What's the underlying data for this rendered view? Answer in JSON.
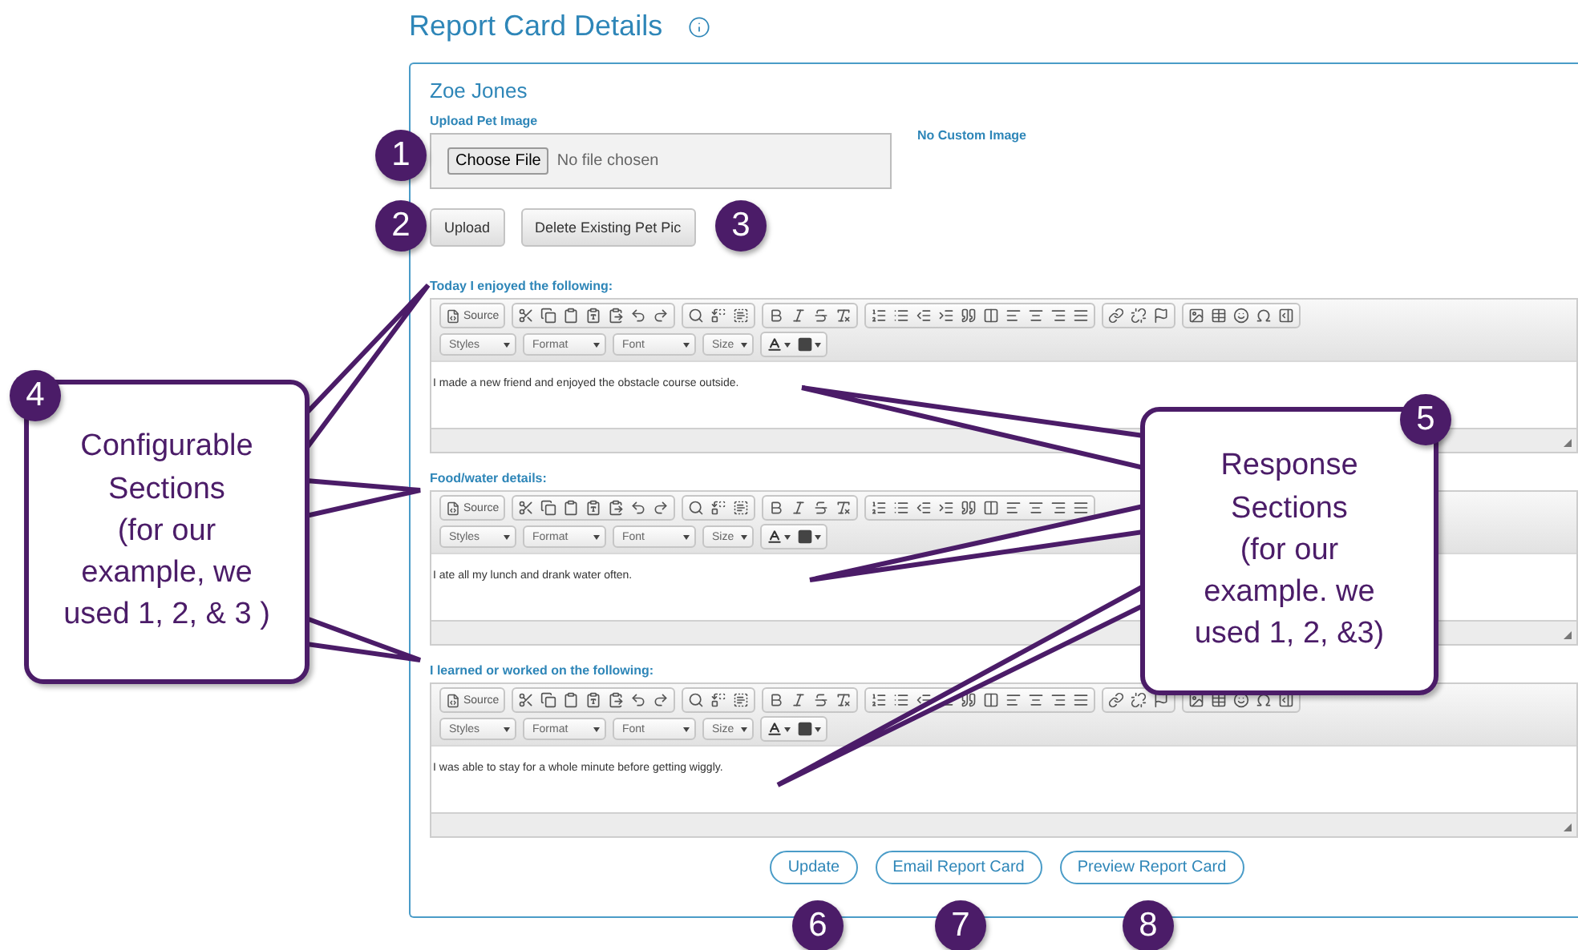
{
  "page": {
    "title": "Report Card Details"
  },
  "pet_name": "Zoe Jones",
  "upload": {
    "label": "Upload Pet Image",
    "choose_button": "Choose File",
    "file_status": "No file chosen",
    "image_status": "No Custom Image"
  },
  "image_buttons": [
    "Upload",
    "Delete Existing Pet Pic"
  ],
  "sections": [
    {
      "label": "Today I enjoyed the following:",
      "source_button": "Source",
      "dropdowns": [
        "Styles",
        "Format",
        "Font",
        "Size"
      ],
      "text": "I made a new friend and enjoyed the obstacle course outside."
    },
    {
      "label": "Food/water details:",
      "source_button": "Source",
      "dropdowns": [
        "Styles",
        "Format",
        "Font",
        "Size"
      ],
      "text": "I ate all my lunch and drank water often."
    },
    {
      "label": "I learned or worked on the following:",
      "source_button": "Source",
      "dropdowns": [
        "Styles",
        "Format",
        "Font",
        "Size"
      ],
      "text": "I was able to stay for a whole minute before getting wiggly."
    }
  ],
  "actions": [
    "Update",
    "Email Report Card",
    "Preview Report Card"
  ],
  "callouts": [
    {
      "number": "1"
    },
    {
      "number": "2"
    },
    {
      "number": "3"
    },
    {
      "number": "4",
      "text": "Configurable\nSections\n(for our\nexample, we\nused 1, 2, & 3 )"
    },
    {
      "number": "5",
      "text": "Response\nSections\n(for our\nexample. we\nused 1, 2, &3)"
    },
    {
      "number": "6"
    },
    {
      "number": "7"
    },
    {
      "number": "8"
    }
  ]
}
